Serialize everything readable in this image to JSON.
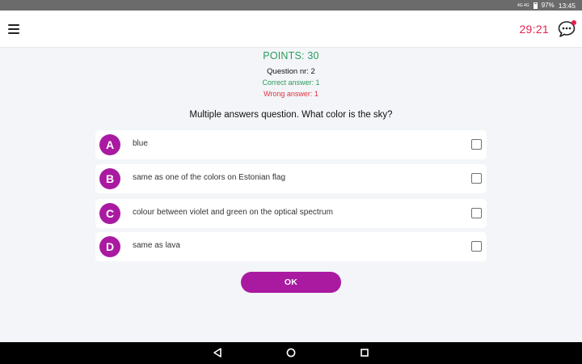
{
  "status_bar": {
    "signal": "4G 4G",
    "battery": "97%",
    "time": "13:45"
  },
  "app_bar": {
    "timer": "29:21",
    "icons": {
      "menu": "hamburger-menu-icon",
      "chat": "chat-bubble-icon"
    },
    "colors": {
      "timer": "#e6204e"
    }
  },
  "quiz": {
    "points": "POINTS: 30",
    "question_nr": "Question nr: 2",
    "correct_answers": "Correct answer: 1",
    "wrong_answers": "Wrong answer: 1",
    "question": "Multiple answers question. What color is the sky?",
    "answers": [
      {
        "letter": "A",
        "text": "blue",
        "checked": false
      },
      {
        "letter": "B",
        "text": "same as one of the colors on Estonian flag",
        "checked": false
      },
      {
        "letter": "C",
        "text": "colour between violet and green on the optical spectrum",
        "checked": false
      },
      {
        "letter": "D",
        "text": "same as lava",
        "checked": false
      }
    ],
    "ok_label": "OK",
    "colors": {
      "accent": "#a91aa1",
      "correct": "#2a9c5c",
      "wrong": "#e0313f"
    }
  },
  "nav_bar": {
    "icons": [
      "back-triangle-icon",
      "home-circle-icon",
      "recents-square-icon"
    ]
  }
}
